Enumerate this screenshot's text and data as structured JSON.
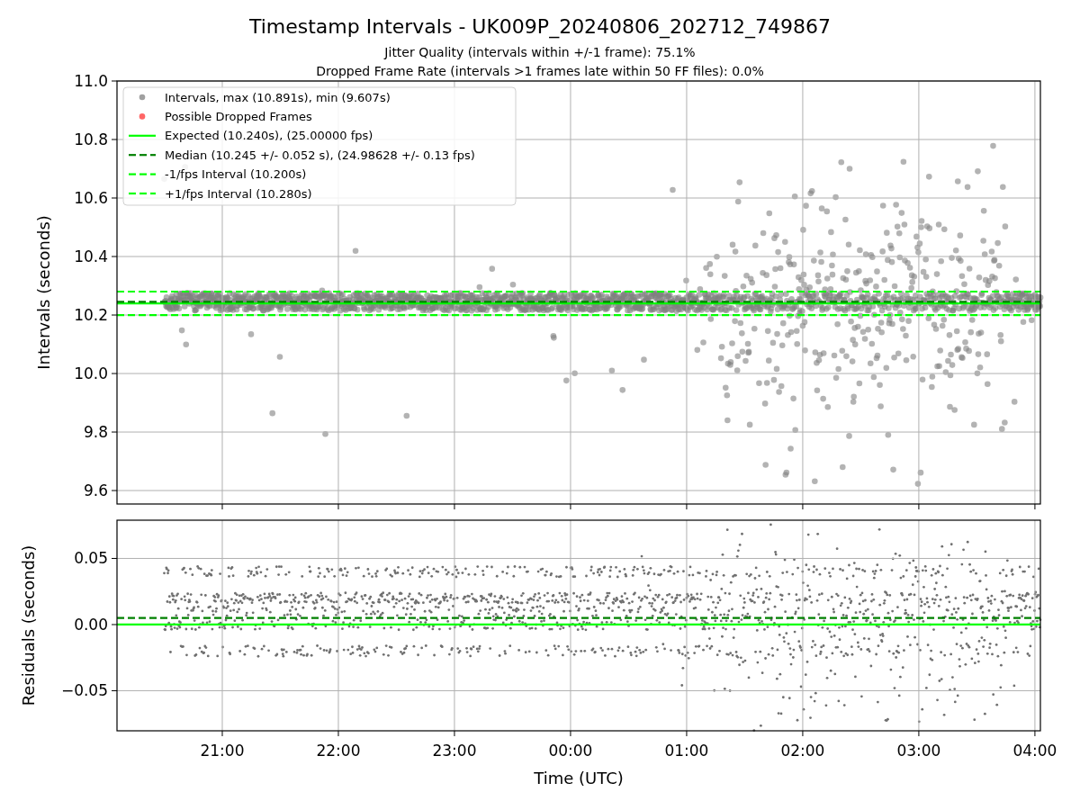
{
  "figure": {
    "title": "Timestamp Intervals - UK009P_20240806_202712_749867",
    "subtitles": [
      "Jitter Quality (intervals within +/-1 frame): 75.1%",
      "Dropped Frame Rate (intervals >1 frames late within 50 FF files): 0.0%"
    ]
  },
  "legend_markers": [
    {
      "label": "Intervals, max (10.891s), min (9.607s)",
      "color": "#a0a0a0"
    },
    {
      "label": "Possible Dropped Frames",
      "color": "#ff6666"
    }
  ],
  "intervals_panel": {
    "chart_data": {
      "type": "line",
      "ylabel": "Intervals (seconds)",
      "grid": true,
      "legend": true,
      "x": [
        "2024-08-06T20:05:35",
        "2024-08-07T04:02:50"
      ],
      "xlim": [
        "2024-08-06T20:05:35",
        "2024-08-07T04:02:50"
      ],
      "ylim": [
        9.554,
        11.0
      ],
      "yticks": [
        {
          "value": 9.6,
          "label": "9.6"
        },
        {
          "value": 9.8,
          "label": "9.8"
        },
        {
          "value": 10.0,
          "label": "10.0"
        },
        {
          "value": 10.2,
          "label": "10.2"
        },
        {
          "value": 10.4,
          "label": "10.4"
        },
        {
          "value": 10.6,
          "label": "10.6"
        },
        {
          "value": 10.8,
          "label": "10.8"
        },
        {
          "value": 11.0,
          "label": "11.0"
        }
      ],
      "series": [
        {
          "name": "Expected (10.240s), (25.00000 fps)",
          "color": "#00ff00",
          "line_style": "solid",
          "values": [
            10.24,
            10.24
          ]
        },
        {
          "name": "Median (10.245 +/- 0.052 s), (24.98628 +/- 0.13 fps)",
          "color": "#008000",
          "line_style": "dashed",
          "values": [
            10.245,
            10.245
          ]
        },
        {
          "name": "-1/fps Interval (10.200s)",
          "color": "#00ff00",
          "line_style": "dashed",
          "values": [
            10.2,
            10.2
          ]
        },
        {
          "name": "+1/fps Interval (10.280s)",
          "color": "#00ff00",
          "line_style": "dashed",
          "values": [
            10.28,
            10.28
          ]
        }
      ]
    }
  },
  "residuals_panel": {
    "chart_data": {
      "type": "line",
      "xlabel": "Time (UTC)",
      "ylabel": "Residuals (seconds)",
      "grid": true,
      "x": [
        "2024-08-06T20:05:35",
        "2024-08-07T04:02:50"
      ],
      "xlim": [
        "2024-08-06T20:05:35",
        "2024-08-07T04:02:50"
      ],
      "ylim": [
        -0.0803,
        0.0789
      ],
      "xticks": [
        {
          "value": "2024-08-06T21:00:00",
          "label": "21:00"
        },
        {
          "value": "2024-08-06T22:00:00",
          "label": "22:00"
        },
        {
          "value": "2024-08-06T23:00:00",
          "label": "23:00"
        },
        {
          "value": "2024-08-07T00:00:00",
          "label": "00:00"
        },
        {
          "value": "2024-08-07T01:00:00",
          "label": "01:00"
        },
        {
          "value": "2024-08-07T02:00:00",
          "label": "02:00"
        },
        {
          "value": "2024-08-07T03:00:00",
          "label": "03:00"
        },
        {
          "value": "2024-08-07T04:00:00",
          "label": "04:00"
        }
      ],
      "yticks": [
        {
          "value": -0.05,
          "label": "−0.05"
        },
        {
          "value": 0,
          "label": "0.00"
        },
        {
          "value": 0.05,
          "label": "0.05"
        }
      ],
      "series": [
        {
          "color": "#00ff00",
          "line_style": "solid",
          "values": [
            0,
            0
          ]
        },
        {
          "color": "#008000",
          "line_style": "dashed",
          "values": [
            0.005,
            0.005
          ]
        }
      ]
    }
  }
}
